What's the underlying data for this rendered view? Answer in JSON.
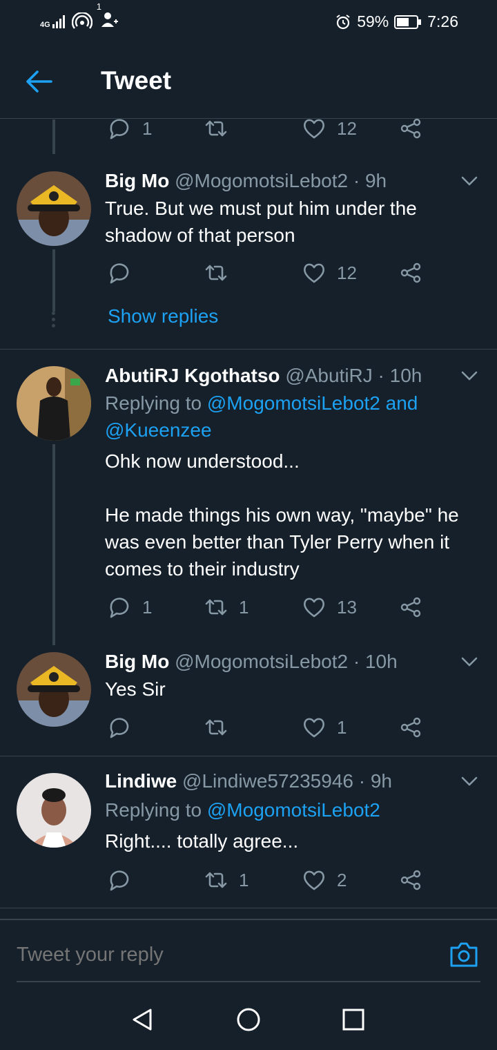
{
  "status_bar": {
    "network": "4G",
    "notification_count": "1",
    "battery": "59%",
    "time": "7:26"
  },
  "header": {
    "title": "Tweet"
  },
  "top_partial_actions": {
    "replies": "1",
    "retweets": "",
    "likes": "12"
  },
  "tweets": [
    {
      "name": "Big Mo",
      "handle": "@MogomotsiLebot2 · 9h",
      "text_lines": [
        "True. But we must put him under the",
        "shadow of that person"
      ],
      "replies": "",
      "retweets": "",
      "likes": "12",
      "show_replies": "Show replies"
    },
    {
      "name": "AbutiRJ Kgothatso",
      "handle": "@AbutiRJ · 10h",
      "replying_label": "Replying to",
      "replying_mention1": "@MogomotsiLebot2 and",
      "replying_mention2": "@Kueenzee",
      "text_lines": [
        "Ohk now understood...",
        "",
        "He made things his own way, \"maybe\" he",
        "was even better than Tyler Perry when it",
        "comes to their industry"
      ],
      "replies": "1",
      "retweets": "1",
      "likes": "13"
    },
    {
      "name": "Big Mo",
      "handle": "@MogomotsiLebot2 · 10h",
      "text_lines": [
        "Yes Sir"
      ],
      "replies": "",
      "retweets": "",
      "likes": "1"
    },
    {
      "name": "Lindiwe",
      "handle": "@Lindiwe57235946 · 9h",
      "replying_label": "Replying to",
      "replying_mention1": "@MogomotsiLebot2",
      "text_lines": [
        "Right.... totally agree..."
      ],
      "replies": "",
      "retweets": "1",
      "likes": "2"
    }
  ],
  "reply_bar": {
    "placeholder": "Tweet your reply"
  },
  "colors": {
    "background": "#15202b",
    "accent": "#1da1f2",
    "secondary_text": "#8899a6",
    "divider": "#38444d"
  }
}
